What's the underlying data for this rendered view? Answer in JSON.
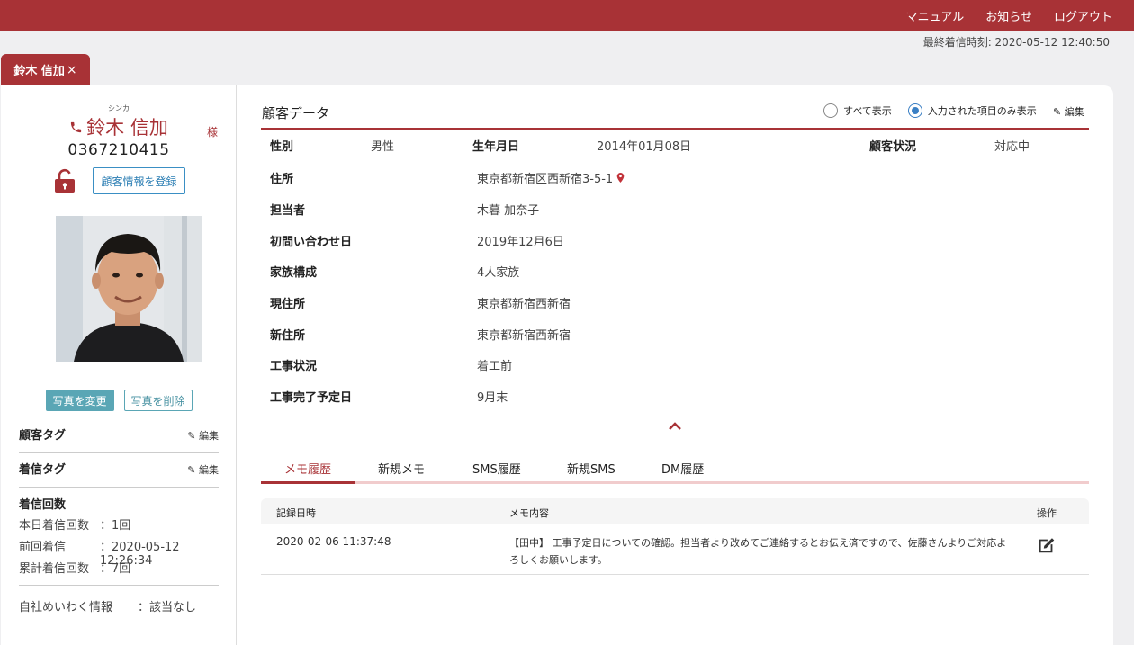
{
  "topbar": {
    "links": [
      "マニュアル",
      "お知らせ",
      "ログアウト"
    ]
  },
  "last_call": "最終着信時刻: 2020-05-12 12:40:50",
  "tab": {
    "label": "鈴木 信加",
    "close": "×"
  },
  "sidebar": {
    "kana": "シンカ",
    "name": "鈴木 信加",
    "honorific": "様",
    "phone": "0367210415",
    "register_button": "顧客情報を登録",
    "photo_change": "写真を変更",
    "photo_delete": "写真を削除",
    "customer_tag": {
      "label": "顧客タグ",
      "edit": "編集"
    },
    "call_tag": {
      "label": "着信タグ",
      "edit": "編集"
    },
    "call_count": {
      "heading": "着信回数",
      "today_label": "本日着信回数",
      "today_value": "：1回",
      "prev_label": "前回着信",
      "prev_value": "：2020-05-12 12:26:34",
      "total_label": "累計着信回数",
      "total_value": "：7回"
    },
    "nuisance": {
      "label": "自社めいわく情報",
      "value": "：該当なし"
    }
  },
  "main": {
    "title": "顧客データ",
    "radio_all": "すべて表示",
    "radio_filled": "入力された項目のみ表示",
    "edit": "編集",
    "fields": {
      "gender_label": "性別",
      "gender_value": "男性",
      "birth_label": "生年月日",
      "birth_value": "2014年01月08日",
      "status_label": "顧客状況",
      "status_value": "対応中",
      "address_label": "住所",
      "address_value": "東京都新宿区西新宿3-5-1",
      "staff_label": "担当者",
      "staff_value": "木暮 加奈子",
      "first_label": "初問い合わせ日",
      "first_value": "2019年12月6日",
      "family_label": "家族構成",
      "family_value": "4人家族",
      "current_label": "現住所",
      "current_value": "東京都新宿西新宿",
      "new_label": "新住所",
      "new_value": "東京都新宿西新宿",
      "work_label": "工事状況",
      "work_value": "着工前",
      "done_label": "工事完了予定日",
      "done_value": "9月末"
    },
    "tabs": [
      "メモ履歴",
      "新規メモ",
      "SMS履歴",
      "新規SMS",
      "DM履歴"
    ],
    "table": {
      "headers": [
        "記録日時",
        "メモ内容",
        "操作"
      ],
      "rows": [
        {
          "date": "2020-02-06 11:37:48",
          "memo": "【田中】 工事予定日についての確認。担当者より改めてご連絡するとお伝え済ですので、佐藤さんよりご対応よろしくお願いします。"
        }
      ]
    }
  },
  "colors": {
    "brand": "#a83236",
    "accent_blue": "#3a7fc4",
    "teal": "#5aa6b5"
  }
}
